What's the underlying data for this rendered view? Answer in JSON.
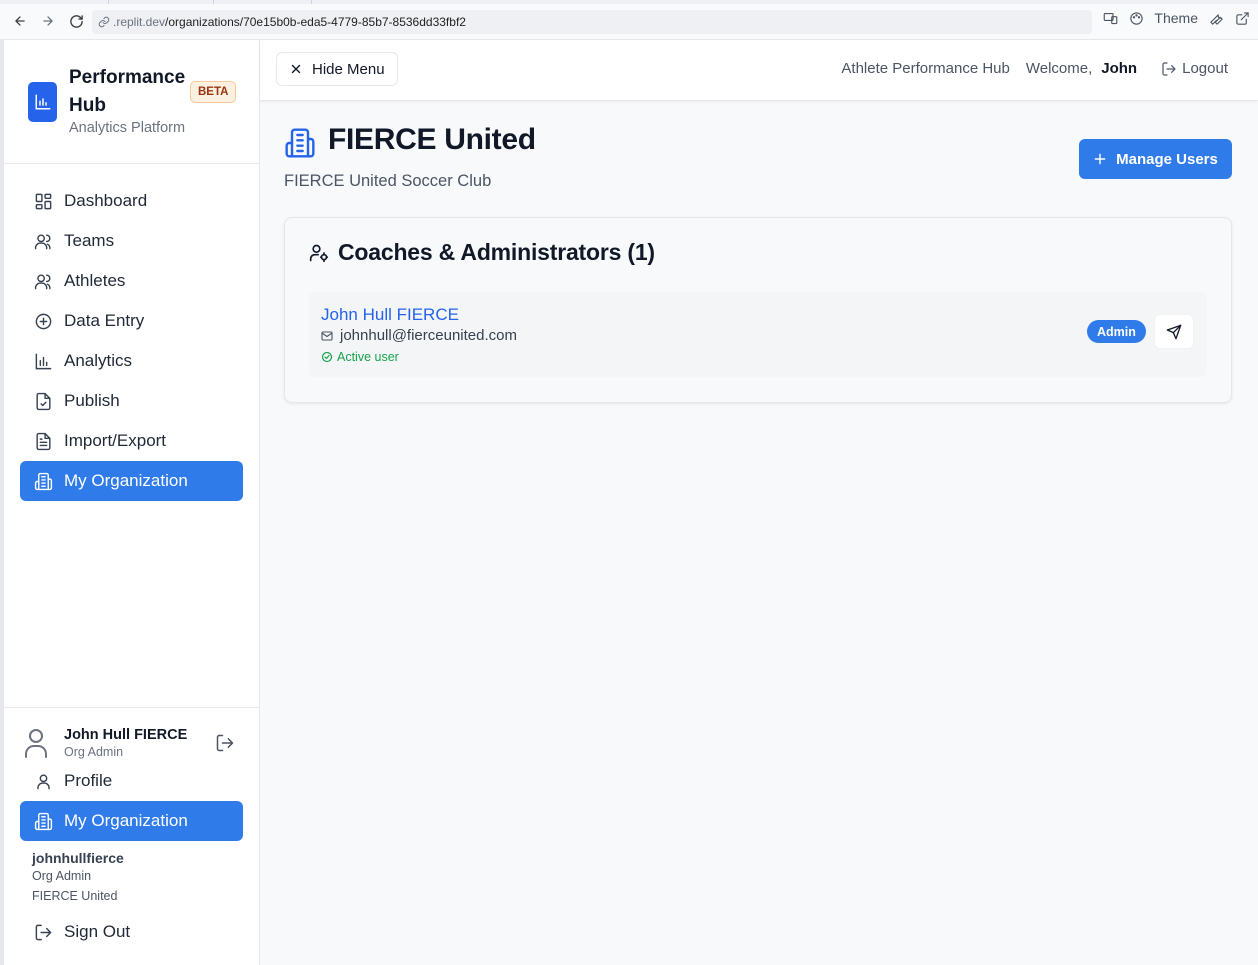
{
  "browser": {
    "url_host": ".replit.dev",
    "url_path": "/organizations/70e15b0b-eda5-4779-85b7-8536dd33fbf2",
    "theme_label": "Theme"
  },
  "brand": {
    "title": "Performance Hub",
    "subtitle": "Analytics Platform",
    "badge": "BETA"
  },
  "sidebar": {
    "items": [
      {
        "label": "Dashboard",
        "icon": "layout-dashboard-icon"
      },
      {
        "label": "Teams",
        "icon": "users-icon"
      },
      {
        "label": "Athletes",
        "icon": "users-icon"
      },
      {
        "label": "Data Entry",
        "icon": "plus-circle-icon"
      },
      {
        "label": "Analytics",
        "icon": "bar-chart-icon"
      },
      {
        "label": "Publish",
        "icon": "file-check-icon"
      },
      {
        "label": "Import/Export",
        "icon": "file-text-icon"
      },
      {
        "label": "My Organization",
        "icon": "building-icon",
        "active": true
      }
    ]
  },
  "footer": {
    "user_name": "John Hull FIERCE",
    "user_role": "Org Admin",
    "profile_label": "Profile",
    "my_org_label": "My Organization",
    "username": "johnhullfierce",
    "account_role": "Org Admin",
    "account_org": "FIERCE United",
    "sign_out_label": "Sign Out"
  },
  "header": {
    "hide_menu_label": "Hide Menu",
    "app_name": "Athlete Performance Hub",
    "welcome_label": "Welcome,",
    "welcome_name": "John",
    "logout_label": "Logout"
  },
  "main": {
    "org_name": "FIERCE United",
    "org_description": "FIERCE United Soccer Club",
    "manage_users_label": "Manage Users",
    "section_title": "Coaches & Administrators (1)",
    "members": [
      {
        "name": "John Hull FIERCE",
        "email": "johnhull@fierceunited.com",
        "status": "Active user",
        "role_badge": "Admin"
      }
    ]
  },
  "colors": {
    "accent": "#2f7bea",
    "link": "#2563eb",
    "success": "#16a34a",
    "beta_bg": "#fdf0e0"
  }
}
